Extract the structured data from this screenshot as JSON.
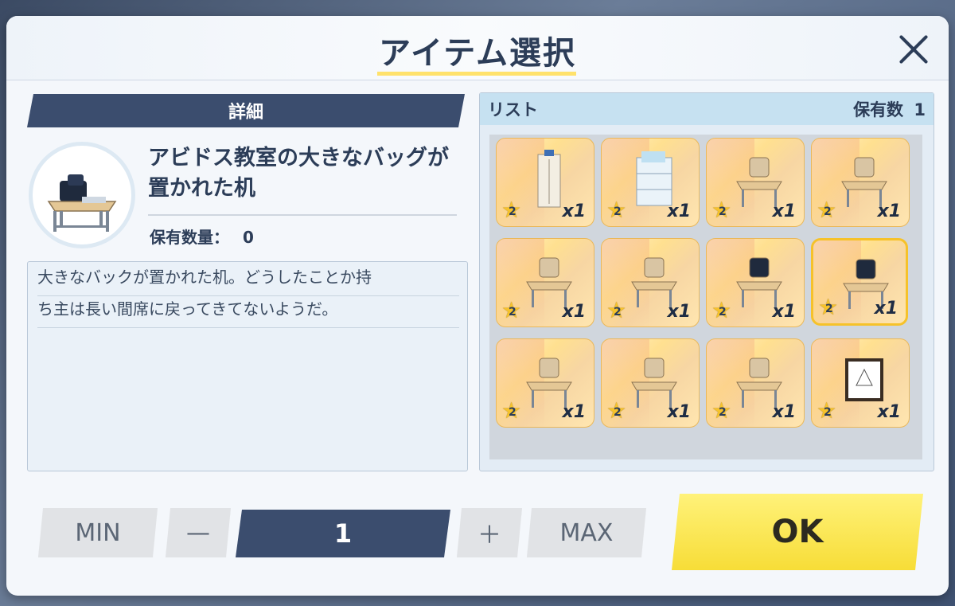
{
  "dialog": {
    "title": "アイテム選択",
    "close_icon": "close-icon"
  },
  "detail": {
    "banner": "詳細",
    "item_name": "アビドス教室の大きなバッグが置かれた机",
    "owned_label": "保有数量：",
    "owned_value": "0",
    "description_lines": [
      "大きなバックが置かれた机。どうしたことか持",
      "ち主は長い間席に戻ってきてないようだ。"
    ]
  },
  "list": {
    "header_label": "リスト",
    "owned_count_label": "保有数",
    "owned_count_value": "1",
    "items": [
      {
        "rarity": "2",
        "qty": "x1",
        "icon": "locker-icon"
      },
      {
        "rarity": "2",
        "qty": "x1",
        "icon": "shelf-icon"
      },
      {
        "rarity": "2",
        "qty": "x1",
        "icon": "desk-with-cushion-icon"
      },
      {
        "rarity": "2",
        "qty": "x1",
        "icon": "desk-with-blue-cushion-icon"
      },
      {
        "rarity": "2",
        "qty": "x1",
        "icon": "desk-with-papers-icon"
      },
      {
        "rarity": "2",
        "qty": "x1",
        "icon": "desk-with-blue-item-icon"
      },
      {
        "rarity": "2",
        "qty": "x1",
        "icon": "desk-with-bag-icon"
      },
      {
        "rarity": "2",
        "qty": "x1",
        "icon": "desk-with-big-bag-icon",
        "selected": true
      },
      {
        "rarity": "2",
        "qty": "x1",
        "icon": "weapon-rack-icon"
      },
      {
        "rarity": "2",
        "qty": "x1",
        "icon": "vending-panel-icon"
      },
      {
        "rarity": "2",
        "qty": "x1",
        "icon": "workbench-icon"
      },
      {
        "rarity": "2",
        "qty": "x1",
        "icon": "framed-picture-icon"
      }
    ]
  },
  "controls": {
    "min_label": "MIN",
    "minus_label": "—",
    "quantity": "1",
    "plus_label": "＋",
    "max_label": "MAX",
    "ok_label": "OK"
  },
  "colors": {
    "navy": "#3b4d6e",
    "accent_yellow": "#f7dd37",
    "list_header": "#c6e1f1"
  }
}
